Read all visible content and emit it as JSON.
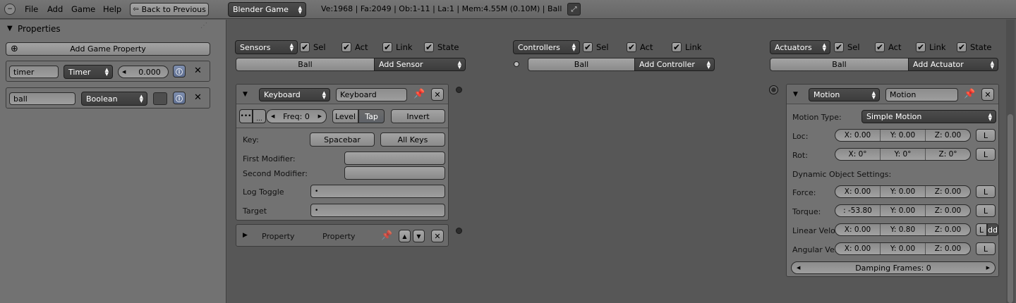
{
  "menu": {
    "file": "File",
    "add": "Add",
    "game": "Game",
    "help": "Help",
    "back": "Back to Previous",
    "engine": "Blender Game",
    "stats": "Ve:1968 | Fa:2049 | Ob:1-11 | La:1 | Mem:4.55M (0.10M) | Ball"
  },
  "properties": {
    "title": "Properties",
    "add_button": "Add Game Property",
    "items": [
      {
        "name": "timer",
        "type": "Timer",
        "value": "0.000"
      },
      {
        "name": "ball",
        "type": "Boolean"
      }
    ]
  },
  "sensors": {
    "menu": "Sensors",
    "sel": "Sel",
    "act": "Act",
    "link": "Link",
    "state": "State",
    "object": "Ball",
    "add": "Add Sensor",
    "keyboard": {
      "type": "Keyboard",
      "name": "Keyboard",
      "freq": "Freq: 0",
      "level": "Level",
      "tap": "Tap",
      "invert": "Invert",
      "key_label": "Key:",
      "key": "Spacebar",
      "all_keys": "All Keys",
      "first_mod": "First Modifier:",
      "second_mod": "Second Modifier:",
      "log_toggle": "Log Toggle",
      "target": "Target"
    },
    "property": {
      "type": "Property",
      "name": "Property"
    }
  },
  "controllers": {
    "menu": "Controllers",
    "sel": "Sel",
    "act": "Act",
    "link": "Link",
    "object": "Ball",
    "add": "Add Controller"
  },
  "actuators": {
    "menu": "Actuators",
    "sel": "Sel",
    "act": "Act",
    "link": "Link",
    "state": "State",
    "object": "Ball",
    "add": "Add Actuator",
    "motion": {
      "type": "Motion",
      "name": "Motion",
      "motion_type_label": "Motion Type:",
      "motion_type": "Simple Motion",
      "loc_label": "Loc:",
      "loc": [
        "X: 0.00",
        "Y: 0.00",
        "Z: 0.00"
      ],
      "rot_label": "Rot:",
      "rot": [
        "X: 0°",
        "Y: 0°",
        "Z: 0°"
      ],
      "dyn_label": "Dynamic Object Settings:",
      "force_label": "Force:",
      "force": [
        "X: 0.00",
        "Y: 0.00",
        "Z: 0.00"
      ],
      "torque_label": "Torque:",
      "torque": [
        ": -53.80",
        "Y: 0.00",
        "Z: 0.00"
      ],
      "linvel_label": "Linear Velo",
      "linvel": [
        "X: 0.00",
        "Y: 0.80",
        "Z: 0.00"
      ],
      "angvel_label": "Angular Vel",
      "angvel": [
        "X: 0.00",
        "Y: 0.00",
        "Z: 0.00"
      ],
      "local": "L",
      "add_btn": "dd",
      "damping": "Damping Frames: 0"
    }
  }
}
